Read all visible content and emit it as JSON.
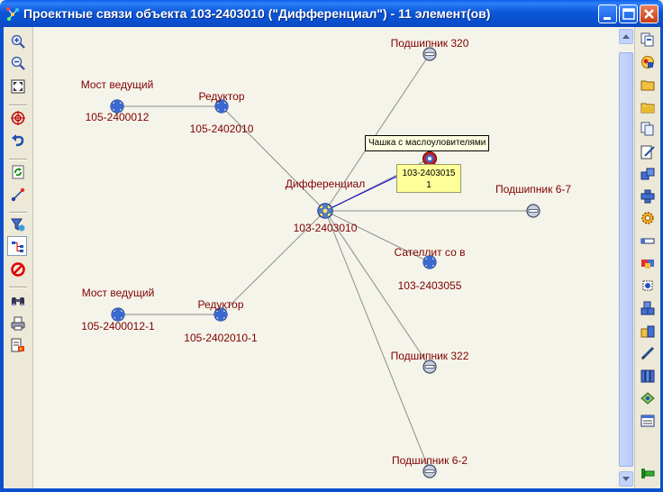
{
  "window": {
    "title": "Проектные связи объекта 103-2403010 (\"Дифференциал\") - 11 элемент(ов)"
  },
  "left_toolbar": [
    {
      "name": "zoom-in-icon"
    },
    {
      "name": "zoom-out-icon"
    },
    {
      "name": "fit-to-window-icon"
    },
    {
      "name": "center-target-icon"
    },
    {
      "name": "undo-arrow-icon"
    },
    {
      "name": "refresh-icon"
    },
    {
      "name": "connect-link-icon"
    },
    {
      "name": "filter-icon"
    },
    {
      "name": "tree-layout-icon",
      "active": true
    },
    {
      "name": "stop-icon"
    },
    {
      "name": "binoculars-icon"
    },
    {
      "name": "print-icon"
    },
    {
      "name": "export-icon"
    }
  ],
  "right_toolbar": [
    "copy-icon",
    "object-properties-icon",
    "open-folder-icon",
    "folder-icon",
    "document-copy-icon",
    "edit-document-icon",
    "assembly-icon",
    "part-icon",
    "settings-gear-icon",
    "bearing-icon",
    "color-parts-icon",
    "component-icon",
    "stack-icon",
    "batch-icon",
    "pencil-icon",
    "library-icon",
    "layer-icon",
    "report-icon",
    "exit-icon"
  ],
  "graph": {
    "nodes": [
      {
        "id": "center",
        "title": "Дифференциал",
        "code": "103-2403010",
        "kind": "center"
      },
      {
        "id": "most1",
        "title": "Мост ведущий",
        "code": "105-2400012",
        "kind": "assembly"
      },
      {
        "id": "red1",
        "title": "Редуктор",
        "code": "105-2402010",
        "kind": "assembly"
      },
      {
        "id": "most2",
        "title": "Мост ведущий",
        "code": "105-2400012-1",
        "kind": "assembly"
      },
      {
        "id": "red2",
        "title": "Редуктор",
        "code": "105-2402010-1",
        "kind": "assembly"
      },
      {
        "id": "p320",
        "title": "Подшипник 320",
        "code": "",
        "kind": "part"
      },
      {
        "id": "chashka",
        "title": "",
        "code": "",
        "kind": "selected"
      },
      {
        "id": "p67",
        "title": "Подшипник 6-7",
        "code": "",
        "kind": "part"
      },
      {
        "id": "satellit",
        "title": "Сателлит со в",
        "code": "103-2403055",
        "kind": "assembly"
      },
      {
        "id": "p322",
        "title": "Подшипник 322",
        "code": "",
        "kind": "part"
      },
      {
        "id": "p62",
        "title": "Подшипник 6-2",
        "code": "",
        "kind": "part"
      }
    ],
    "tooltip": "Чашка с маслоуловителями",
    "link_info": {
      "code": "103-2403015",
      "quantity": "1"
    }
  }
}
